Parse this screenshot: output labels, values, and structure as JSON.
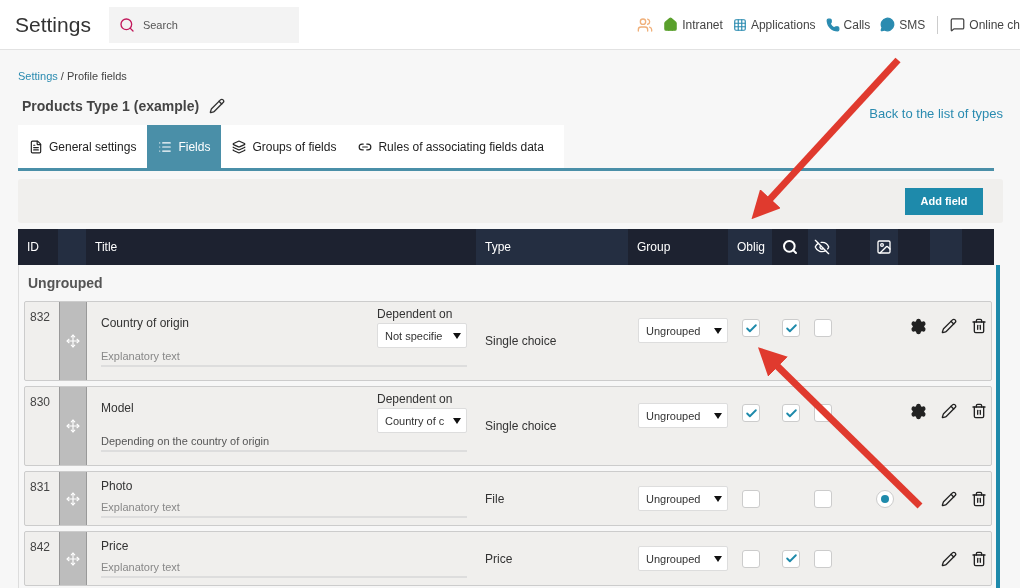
{
  "header": {
    "title": "Settings",
    "search": {
      "placeholder": "Search"
    },
    "nav": [
      {
        "kind": "people"
      },
      {
        "kind": "home",
        "label": "Intranet"
      },
      {
        "kind": "apps",
        "label": "Applications"
      },
      {
        "kind": "phone",
        "label": "Calls"
      },
      {
        "kind": "chat",
        "label": "SMS"
      },
      {
        "kind": "chat-outline",
        "label": "Online ch"
      }
    ]
  },
  "breadcrumb": {
    "link": "Settings",
    "rest": "/ Profile fields"
  },
  "page_title": "Products Type 1 (example)",
  "back_link": "Back to the list of types",
  "tabs": [
    {
      "kind": "doc",
      "label": "General settings",
      "selected": false
    },
    {
      "kind": "list",
      "label": "Fields",
      "selected": true
    },
    {
      "kind": "layers",
      "label": "Groups of fields",
      "selected": false
    },
    {
      "kind": "link",
      "label": "Rules of associating fields data",
      "selected": false
    }
  ],
  "add_button": "Add field",
  "columns": [
    {
      "kind": "text",
      "label": "ID"
    },
    {
      "kind": "blank"
    },
    {
      "kind": "text",
      "label": "Title"
    },
    {
      "kind": "text",
      "label": "Type"
    },
    {
      "kind": "text",
      "label": "Group"
    },
    {
      "kind": "text",
      "label": "Oblig"
    },
    {
      "kind": "search"
    },
    {
      "kind": "eye-off"
    },
    {
      "kind": "blank"
    },
    {
      "kind": "image"
    },
    {
      "kind": "blank"
    },
    {
      "kind": "blank"
    },
    {
      "kind": "blank"
    }
  ],
  "group": {
    "title": "Ungrouped",
    "rows": [
      {
        "id": "832",
        "title": "Country of origin",
        "hint": "Explanatory text",
        "hint_filled": false,
        "dependent": {
          "label": "Dependent on",
          "value": "Not specifie"
        },
        "type": "Single choice",
        "group": "Ungrouped",
        "obligatory": true,
        "searchable": true,
        "hidden": false,
        "settings": true
      },
      {
        "id": "830",
        "title": "Model",
        "hint": "Depending on the country of origin",
        "hint_filled": true,
        "dependent": {
          "label": "Dependent on",
          "value": "Country of c"
        },
        "type": "Single choice",
        "group": "Ungrouped",
        "obligatory": true,
        "searchable": true,
        "hidden": false,
        "settings": true
      },
      {
        "id": "831",
        "title": "Photo",
        "hint": "Explanatory text",
        "hint_filled": false,
        "type": "File",
        "group": "Ungrouped",
        "obligatory": false,
        "hidden": false,
        "image": {
          "selected": true
        },
        "settings": false
      },
      {
        "id": "842",
        "title": "Price",
        "hint": "Explanatory text",
        "hint_filled": false,
        "type": "Price",
        "group": "Ungrouped",
        "obligatory": false,
        "searchable": true,
        "hidden": false,
        "settings": false
      }
    ]
  }
}
